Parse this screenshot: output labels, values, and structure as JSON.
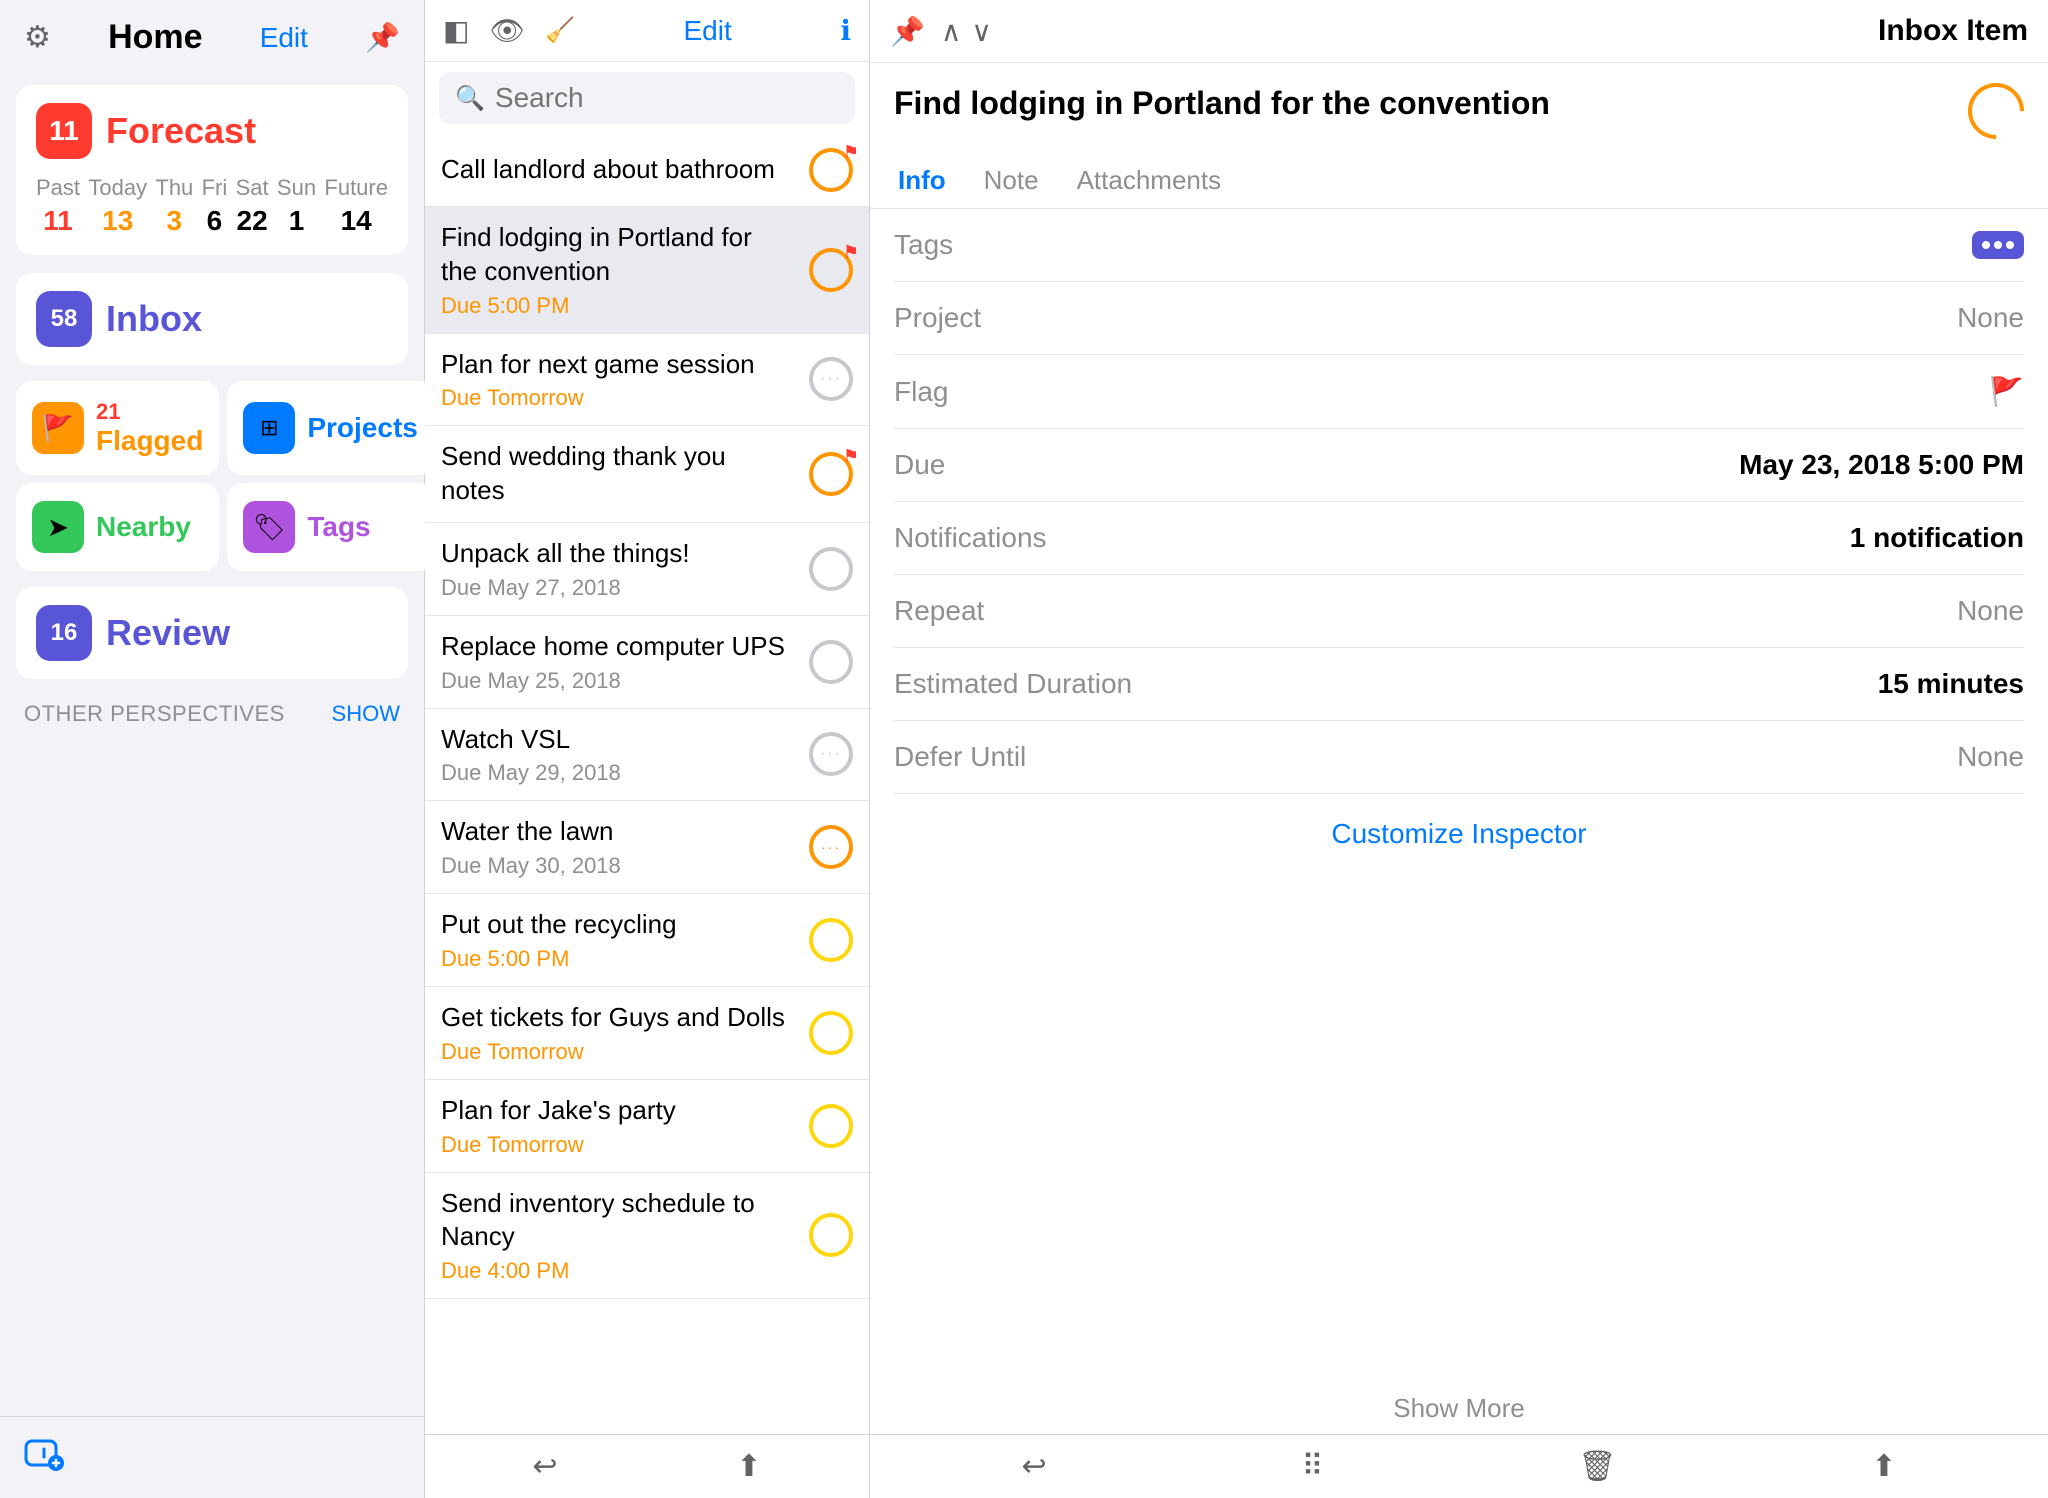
{
  "left": {
    "header": {
      "title": "Home",
      "edit_label": "Edit",
      "gear_icon": "gear-icon",
      "pin_icon": "pin-icon"
    },
    "forecast": {
      "badge": "11",
      "label": "Forecast",
      "days": [
        {
          "name": "Past",
          "count": "11",
          "color": "red"
        },
        {
          "name": "Today",
          "count": "13",
          "color": "orange"
        },
        {
          "name": "Thu",
          "count": "3",
          "color": "orange"
        },
        {
          "name": "Fri",
          "count": "6",
          "color": "normal"
        },
        {
          "name": "Sat",
          "count": "22",
          "color": "normal"
        },
        {
          "name": "Sun",
          "count": "1",
          "color": "normal"
        },
        {
          "name": "Future",
          "count": "14",
          "color": "normal"
        }
      ]
    },
    "inbox": {
      "badge": "58",
      "label": "Inbox"
    },
    "grid": [
      {
        "icon": "flag-icon",
        "icon_color": "orange",
        "label": "Flagged",
        "count": "21"
      },
      {
        "icon": "grid-icon",
        "icon_color": "blue",
        "label": "Projects",
        "count": ""
      },
      {
        "icon": "location-icon",
        "icon_color": "green",
        "label": "Nearby",
        "count": ""
      },
      {
        "icon": "tag-icon",
        "icon_color": "purple",
        "label": "Tags",
        "count": ""
      }
    ],
    "review": {
      "badge": "16",
      "label": "Review"
    },
    "other_perspectives": {
      "label": "OTHER PERSPECTIVES",
      "show_label": "SHOW"
    },
    "add_item_label": "⊕"
  },
  "middle": {
    "search_placeholder": "Search",
    "edit_label": "Edit",
    "tasks": [
      {
        "title": "Call landlord about bathroom",
        "due": "",
        "circle": "orange-flag",
        "selected": false
      },
      {
        "title": "Find lodging in Portland for the convention",
        "due": "Due 5:00 PM",
        "due_color": "yellow",
        "circle": "orange-flag",
        "selected": true
      },
      {
        "title": "Plan for next game session",
        "due": "Due Tomorrow",
        "due_color": "yellow",
        "circle": "gray-dots",
        "selected": false
      },
      {
        "title": "Send wedding thank you notes",
        "due": "",
        "circle": "orange-flag",
        "selected": false
      },
      {
        "title": "Unpack all the things!",
        "due": "Due May 27, 2018",
        "due_color": "gray",
        "circle": "gray",
        "selected": false
      },
      {
        "title": "Replace home computer UPS",
        "due": "Due May 25, 2018",
        "due_color": "gray",
        "circle": "gray",
        "selected": false
      },
      {
        "title": "Watch VSL",
        "due": "Due May 29, 2018",
        "due_color": "gray",
        "circle": "gray-dots",
        "selected": false
      },
      {
        "title": "Water the lawn",
        "due": "Due May 30, 2018",
        "due_color": "gray",
        "circle": "orange-dots",
        "selected": false
      },
      {
        "title": "Put out the recycling",
        "due": "Due 5:00 PM",
        "due_color": "yellow",
        "circle": "yellow",
        "selected": false
      },
      {
        "title": "Get tickets for Guys and Dolls",
        "due": "Due Tomorrow",
        "due_color": "yellow",
        "circle": "yellow",
        "selected": false
      },
      {
        "title": "Plan for Jake's party",
        "due": "Due Tomorrow",
        "due_color": "yellow",
        "circle": "yellow",
        "selected": false
      },
      {
        "title": "Send inventory schedule to Nancy",
        "due": "Due 4:00 PM",
        "due_color": "yellow",
        "circle": "yellow",
        "selected": false
      }
    ]
  },
  "right": {
    "header_title": "Inbox Item",
    "task_title": "Find lodging in Portland for the convention",
    "tabs": [
      {
        "label": "Info",
        "active": true
      },
      {
        "label": "Note",
        "active": false
      },
      {
        "label": "Attachments",
        "active": false
      }
    ],
    "info_rows": [
      {
        "label": "Tags",
        "value": "",
        "type": "tags-icon"
      },
      {
        "label": "Project",
        "value": "None",
        "type": "gray"
      },
      {
        "label": "Flag",
        "value": "",
        "type": "flag"
      },
      {
        "label": "Due",
        "value": "May 23, 2018  5:00 PM",
        "type": "bold"
      },
      {
        "label": "Notifications",
        "value": "1 notification",
        "type": "bold"
      },
      {
        "label": "Repeat",
        "value": "None",
        "type": "gray"
      },
      {
        "label": "Estimated Duration",
        "value": "15 minutes",
        "type": "bold"
      },
      {
        "label": "Defer Until",
        "value": "None",
        "type": "gray"
      }
    ],
    "customize_label": "Customize Inspector",
    "show_more_label": "Show More"
  }
}
